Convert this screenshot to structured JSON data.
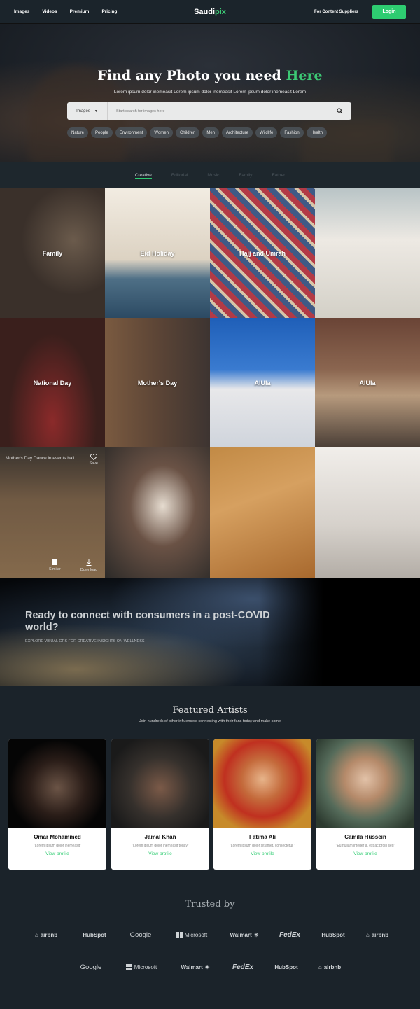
{
  "nav": {
    "links": [
      "Images",
      "Videos",
      "Premium",
      "Pricing"
    ],
    "brand_a": "Saudi",
    "brand_b": "pix",
    "suppliers": "For Content Suppliers",
    "login": "Login",
    "accent": "#2ecc71"
  },
  "hero": {
    "title_a": "Find any Photo you need ",
    "title_b": "Here",
    "subtitle": "Lorem ipsum dolor inemeasit  Lorem ipsum dolor inemeasit Lorem ipsum dolor inemeasit Lorem",
    "search_type": "Images",
    "search_placeholder": "Start search for images here",
    "chips": [
      "Nature",
      "People",
      "Environment",
      "Women",
      "Children",
      "Men",
      "Architecture",
      "Wildlife",
      "Fashion",
      "Health"
    ]
  },
  "tabs": [
    "Creative",
    "Editorial",
    "Music",
    "Family",
    "Father"
  ],
  "grid": [
    {
      "label": "Family"
    },
    {
      "label": "Eid Holiday"
    },
    {
      "label": "Hajj and Umrah"
    },
    {
      "label": ""
    },
    {
      "label": "National Day"
    },
    {
      "label": "Mother's Day"
    },
    {
      "label": "AlUla"
    },
    {
      "label": "AlUla"
    },
    {
      "label": "",
      "caption": "Mother's Day Dance in events hall",
      "save": "Save",
      "similar": "Similar",
      "download": "Download"
    },
    {
      "label": ""
    },
    {
      "label": ""
    },
    {
      "label": ""
    }
  ],
  "banner": {
    "title": "Ready to connect with consumers in a post-COVID world?",
    "sub": "EXPLORE VISUAL GPS FOR CREATIVE INSIGHTS ON WELLNESS"
  },
  "featured": {
    "title": "Featured Artists",
    "sub": "Join hundreds of other influencers connecting with their fans today and make some",
    "artists": [
      {
        "name": "Omar Mohammed",
        "quote": "\"Lorem ipsum dolor inemeasit\"",
        "link": "View profile"
      },
      {
        "name": "Jamal Khan",
        "quote": "\"Lorem ipsum dolor inemeasit today\"",
        "link": "View profile"
      },
      {
        "name": "Fatima Ali",
        "quote": "\"Lorem ipsum dolor sit amet, consectetur \"",
        "link": "View profile"
      },
      {
        "name": "Camila Hussein",
        "quote": "\"Eu nullam integer a, est ac proin sed\"",
        "link": "View profile"
      }
    ]
  },
  "trusted": {
    "title": "Trusted by",
    "row1": [
      "airbnb",
      "HubSpot",
      "Google",
      "Microsoft",
      "Walmart",
      "FedEx",
      "HubSpot",
      "airbnb"
    ],
    "row2": [
      "Google",
      "Microsoft",
      "Walmart",
      "FedEx",
      "HubSpot",
      "airbnb"
    ]
  }
}
